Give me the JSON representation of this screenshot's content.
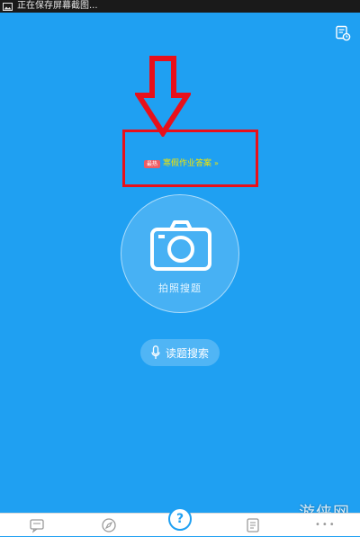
{
  "statusbar": {
    "text": "正在保存屏幕截图..."
  },
  "promo": {
    "tag": "最热",
    "text": "寒假作业答案",
    "chevron": "»"
  },
  "camera": {
    "label": "拍照搜题"
  },
  "voice": {
    "label": "读题搜索"
  },
  "watermark": {
    "text": "游侠网"
  },
  "bottom_nav": {
    "center_label": "?",
    "more_label": "•••"
  },
  "icons": [
    "image-icon",
    "history-icon",
    "camera-icon",
    "microphone-icon",
    "message-icon",
    "compass-icon",
    "question-icon",
    "list-icon",
    "more-icon"
  ],
  "colors": {
    "background": "#1fa0f2",
    "highlight_box": "#e8101a",
    "promo_text": "#f4e400",
    "tag": "#f05c63"
  }
}
